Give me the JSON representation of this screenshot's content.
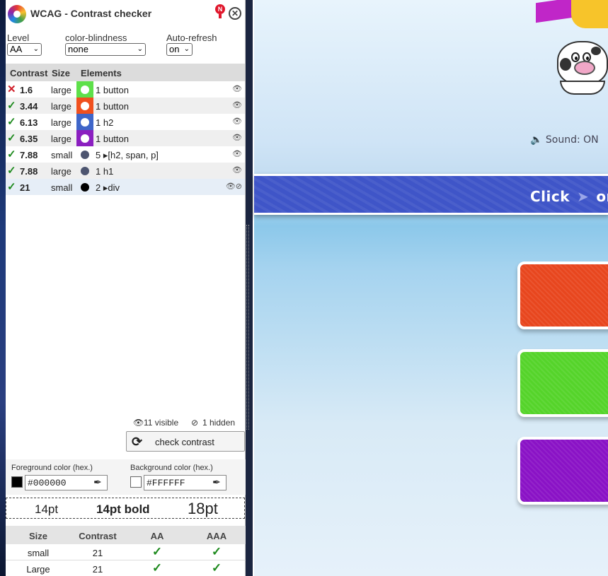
{
  "panel": {
    "title": "WCAG - Contrast checker",
    "notification_badge": "N",
    "close_glyph": "✕"
  },
  "settings": {
    "level": {
      "label": "Level",
      "value": "AA"
    },
    "color_blindness": {
      "label": "color-blindness",
      "value": "none"
    },
    "auto_refresh": {
      "label": "Auto-refresh",
      "value": "on"
    }
  },
  "table": {
    "headers": {
      "contrast": "Contrast",
      "size": "Size",
      "elements": "Elements"
    },
    "rows": [
      {
        "status": "fail",
        "contrast": "1.6",
        "size": "large",
        "swatch": "#5ee04a",
        "dot": "#ffffff",
        "elements": "1 button"
      },
      {
        "status": "ok",
        "contrast": "3.44",
        "size": "large",
        "swatch": "#f0501e",
        "dot": "#ffffff",
        "elements": "1 button"
      },
      {
        "status": "ok",
        "contrast": "6.13",
        "size": "large",
        "swatch": "#3f66c9",
        "dot": "#ffffff",
        "elements": "1 h2"
      },
      {
        "status": "ok",
        "contrast": "6.35",
        "size": "large",
        "swatch": "#8b1fc0",
        "dot": "#ffffff",
        "elements": "1 button"
      },
      {
        "status": "ok",
        "contrast": "7.88",
        "size": "small",
        "swatch": "transparent",
        "dot": "#4d5570",
        "elements": "5 ▸[h2, span, p]"
      },
      {
        "status": "ok",
        "contrast": "7.88",
        "size": "large",
        "swatch": "transparent",
        "dot": "#4d5570",
        "elements": "1 h1"
      },
      {
        "status": "ok",
        "contrast": "21",
        "size": "small",
        "swatch": "transparent",
        "dot": "#000000",
        "elements": "2 ▸div"
      }
    ]
  },
  "visibility": {
    "visible": "11 visible",
    "hidden": "1 hidden"
  },
  "check_button": {
    "label": "check contrast"
  },
  "color_inputs": {
    "foreground": {
      "label": "Foreground color (hex.)",
      "value": "#000000",
      "swatch": "#000000"
    },
    "background": {
      "label": "Background color (hex.)",
      "value": "#FFFFFF",
      "swatch": "#FFFFFF"
    }
  },
  "preview": {
    "normal": "14pt",
    "bold": "14pt bold",
    "large": "18pt"
  },
  "results": {
    "headers": {
      "size": "Size",
      "contrast": "Contrast",
      "aa": "AA",
      "aaa": "AAA"
    },
    "rows": [
      {
        "size": "small",
        "contrast": "21",
        "aa": "✓",
        "aaa": "✓"
      },
      {
        "size": "Large",
        "contrast": "21",
        "aa": "✓",
        "aaa": "✓"
      }
    ]
  },
  "game": {
    "sound": "Sound: ON",
    "banner_click": "Click",
    "banner_or": "or",
    "button_colors": [
      "#e8461e",
      "#55d42a",
      "#8a12c6"
    ]
  },
  "colors": {
    "ok": "#1e8a1e",
    "fail": "#d0202a",
    "banner": "#3f55c8"
  }
}
